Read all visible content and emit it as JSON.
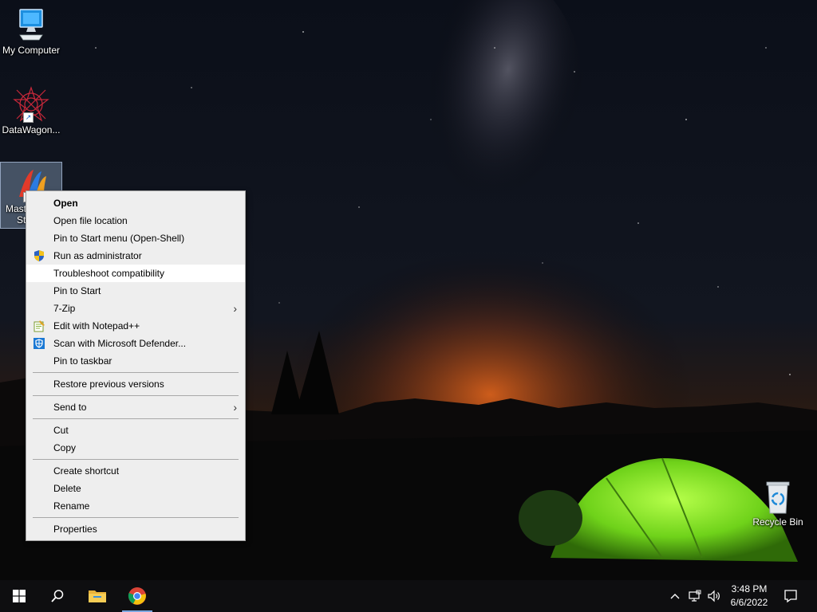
{
  "desktop": {
    "icons": [
      {
        "label": "My Computer"
      },
      {
        "label": "DataWagon..."
      },
      {
        "label_line1": "Mast",
        "label_line2": "St"
      },
      {
        "label": "Recycle Bin"
      }
    ]
  },
  "context_menu": {
    "items": [
      {
        "label": "Open"
      },
      {
        "label": "Open file location"
      },
      {
        "label": "Pin to Start menu (Open-Shell)"
      },
      {
        "label": "Run as administrator"
      },
      {
        "label": "Troubleshoot compatibility"
      },
      {
        "label": "Pin to Start"
      },
      {
        "label": "7-Zip"
      },
      {
        "label": "Edit with Notepad++"
      },
      {
        "label": "Scan with Microsoft Defender..."
      },
      {
        "label": "Pin to taskbar"
      },
      {
        "label": "Restore previous versions"
      },
      {
        "label": "Send to"
      },
      {
        "label": "Cut"
      },
      {
        "label": "Copy"
      },
      {
        "label": "Create shortcut"
      },
      {
        "label": "Delete"
      },
      {
        "label": "Rename"
      },
      {
        "label": "Properties"
      }
    ],
    "submenu_glyph": "›"
  },
  "taskbar": {
    "clock_time": "3:48 PM",
    "clock_date": "6/6/2022",
    "accent_color": "#7aa7e0"
  }
}
